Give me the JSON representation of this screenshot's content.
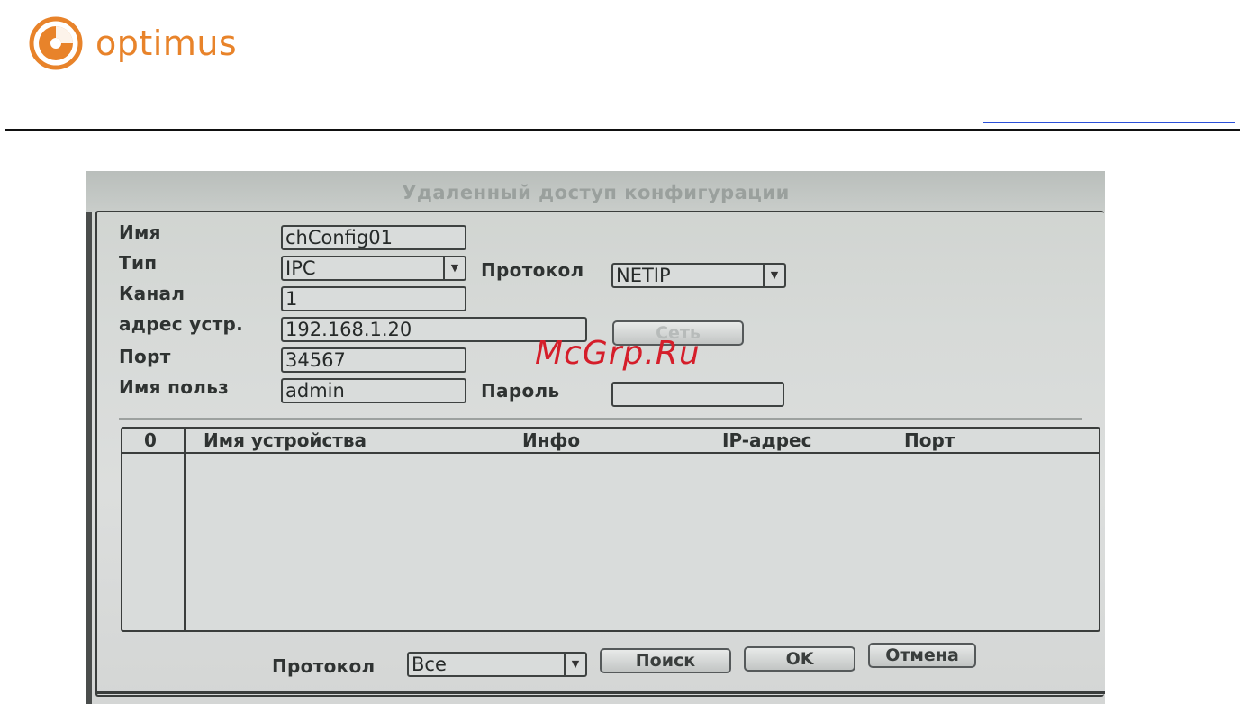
{
  "brand": {
    "name": "optimus",
    "color": "#e8832a"
  },
  "dialog": {
    "title": "Удаленный доступ конфигурации",
    "labels": {
      "name": "Имя",
      "type": "Тип",
      "protocol": "Протокол",
      "channel": "Канал",
      "address": "адрес устр.",
      "port": "Порт",
      "username": "Имя польз",
      "password": "Пароль"
    },
    "values": {
      "name": "chConfig01",
      "type": "IPC",
      "protocol": "NETIP",
      "channel": "1",
      "address": "192.168.1.20",
      "port": "34567",
      "username": "admin",
      "password": ""
    },
    "network_button": "Сеть",
    "table": {
      "columns": [
        "0",
        "Имя устройства",
        "Инфо",
        "IP-адрес",
        "Порт"
      ],
      "rows": []
    },
    "footer": {
      "protocol_label": "Протокол",
      "protocol_value": "Все",
      "search_button": "Поиск",
      "ok_button": "OK",
      "cancel_button": "Отмена"
    }
  },
  "watermark": "McGrp.Ru"
}
